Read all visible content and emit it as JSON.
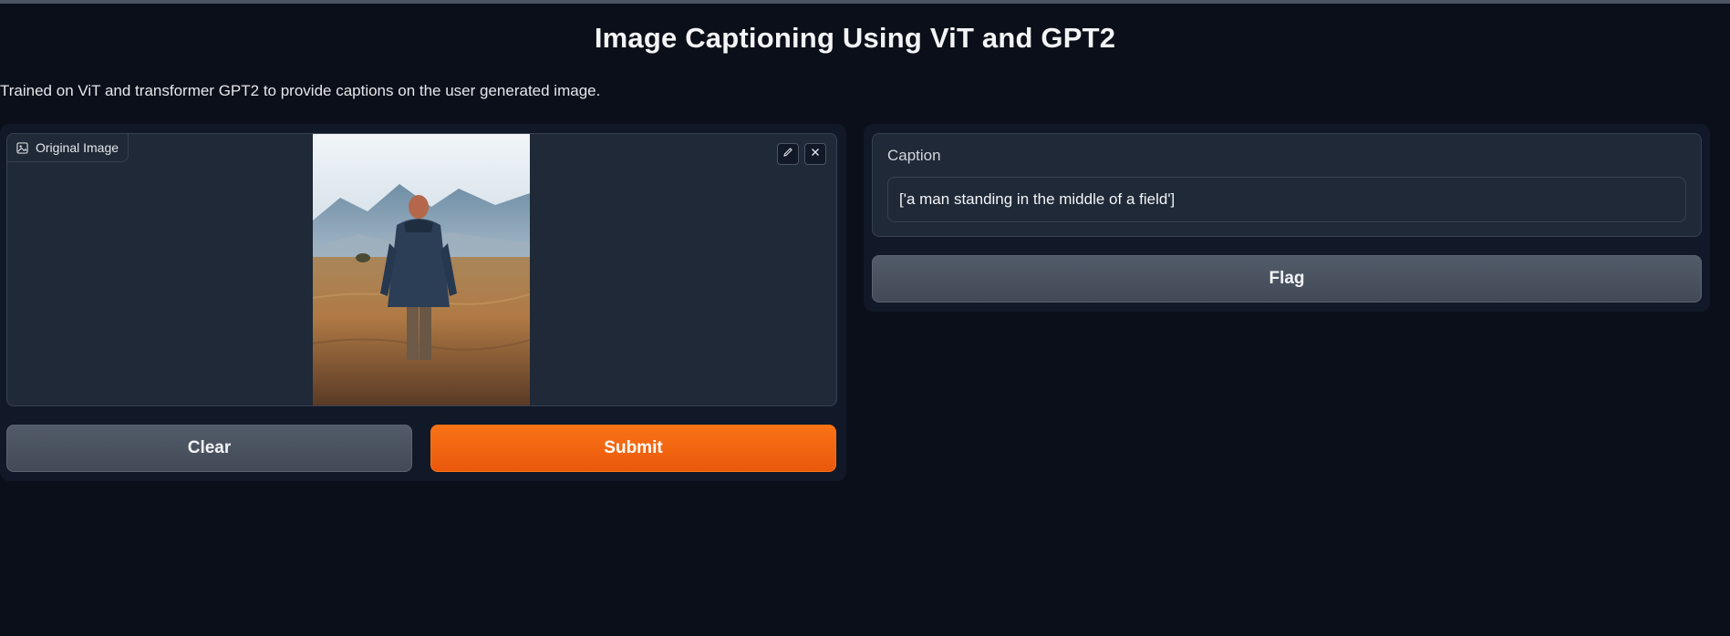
{
  "header": {
    "title": "Image Captioning Using ViT and GPT2",
    "description": "Trained on ViT and transformer GPT2 to provide captions on the user generated image."
  },
  "input_panel": {
    "image_label": "Original Image",
    "label_icon": "image-icon",
    "edit_icon": "pencil-icon",
    "close_icon": "close-icon",
    "clear_label": "Clear",
    "submit_label": "Submit"
  },
  "output_panel": {
    "caption_label": "Caption",
    "caption_value": "['a man standing in the middle of a field']",
    "flag_label": "Flag"
  },
  "colors": {
    "background": "#0b0f19",
    "panel": "#111827",
    "block": "#1f2937",
    "primary_accent": "#f97316",
    "secondary_button": "#4b5563"
  }
}
